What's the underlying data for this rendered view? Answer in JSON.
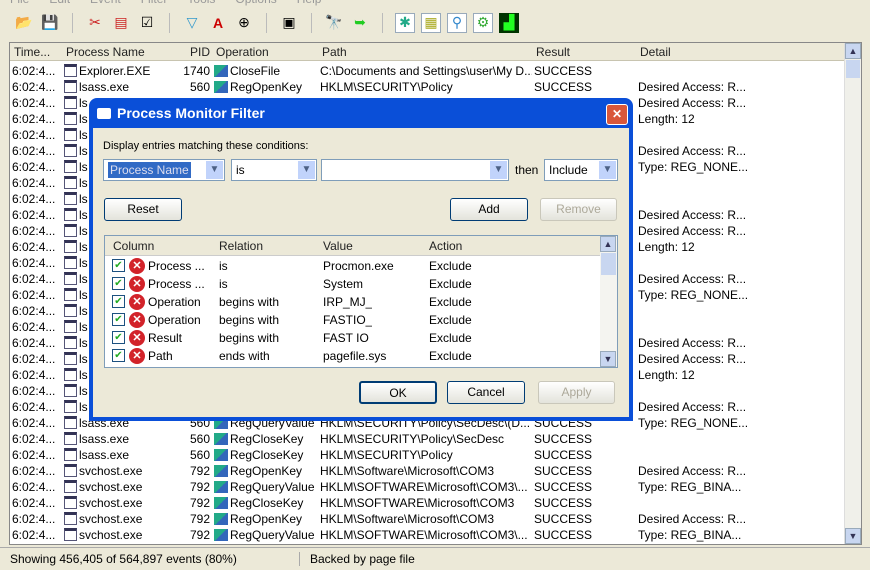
{
  "menu": [
    "File",
    "Edit",
    "Event",
    "Filter",
    "Tools",
    "Options",
    "Help"
  ],
  "columns": [
    "Time...",
    "Process Name",
    "PID",
    "Operation",
    "Path",
    "Result",
    "Detail"
  ],
  "rows": [
    {
      "time": "6:02:4...",
      "process": "Explorer.EXE",
      "pid": "1740",
      "op": "CloseFile",
      "path": "C:\\Documents and Settings\\user\\My D...",
      "result": "SUCCESS",
      "detail": ""
    },
    {
      "time": "6:02:4...",
      "process": "lsass.exe",
      "pid": "560",
      "op": "RegOpenKey",
      "path": "HKLM\\SECURITY\\Policy",
      "result": "SUCCESS",
      "detail": "Desired Access: R..."
    },
    {
      "time": "6:02:4...",
      "process": "ls",
      "pid": "",
      "op": "",
      "path": "",
      "result": "",
      "detail": "Desired Access: R..."
    },
    {
      "time": "6:02:4...",
      "process": "ls",
      "pid": "",
      "op": "",
      "path": "",
      "result": "",
      "detail": "Length: 12"
    },
    {
      "time": "6:02:4...",
      "process": "ls",
      "pid": "",
      "op": "",
      "path": "",
      "result": "",
      "detail": ""
    },
    {
      "time": "6:02:4...",
      "process": "ls",
      "pid": "",
      "op": "",
      "path": "",
      "result": "",
      "detail": "Desired Access: R..."
    },
    {
      "time": "6:02:4...",
      "process": "ls",
      "pid": "",
      "op": "",
      "path": "",
      "result": "",
      "detail": "Type: REG_NONE..."
    },
    {
      "time": "6:02:4...",
      "process": "ls",
      "pid": "",
      "op": "",
      "path": "",
      "result": "",
      "detail": ""
    },
    {
      "time": "6:02:4...",
      "process": "ls",
      "pid": "",
      "op": "",
      "path": "",
      "result": "",
      "detail": ""
    },
    {
      "time": "6:02:4...",
      "process": "ls",
      "pid": "",
      "op": "",
      "path": "",
      "result": "",
      "detail": "Desired Access: R..."
    },
    {
      "time": "6:02:4...",
      "process": "ls",
      "pid": "",
      "op": "",
      "path": "",
      "result": "",
      "detail": "Desired Access: R..."
    },
    {
      "time": "6:02:4...",
      "process": "ls",
      "pid": "",
      "op": "",
      "path": "",
      "result": "",
      "detail": "Length: 12"
    },
    {
      "time": "6:02:4...",
      "process": "ls",
      "pid": "",
      "op": "",
      "path": "",
      "result": "",
      "detail": ""
    },
    {
      "time": "6:02:4...",
      "process": "ls",
      "pid": "",
      "op": "",
      "path": "",
      "result": "",
      "detail": "Desired Access: R..."
    },
    {
      "time": "6:02:4...",
      "process": "ls",
      "pid": "",
      "op": "",
      "path": "",
      "result": "",
      "detail": "Type: REG_NONE..."
    },
    {
      "time": "6:02:4...",
      "process": "ls",
      "pid": "",
      "op": "",
      "path": "",
      "result": "",
      "detail": ""
    },
    {
      "time": "6:02:4...",
      "process": "ls",
      "pid": "",
      "op": "",
      "path": "",
      "result": "",
      "detail": ""
    },
    {
      "time": "6:02:4...",
      "process": "ls",
      "pid": "",
      "op": "",
      "path": "",
      "result": "",
      "detail": "Desired Access: R..."
    },
    {
      "time": "6:02:4...",
      "process": "ls",
      "pid": "",
      "op": "",
      "path": "",
      "result": "",
      "detail": "Desired Access: R..."
    },
    {
      "time": "6:02:4...",
      "process": "ls",
      "pid": "",
      "op": "",
      "path": "",
      "result": "",
      "detail": "Length: 12"
    },
    {
      "time": "6:02:4...",
      "process": "ls",
      "pid": "",
      "op": "",
      "path": "",
      "result": "",
      "detail": ""
    },
    {
      "time": "6:02:4...",
      "process": "ls",
      "pid": "",
      "op": "",
      "path": "",
      "result": "",
      "detail": "Desired Access: R..."
    },
    {
      "time": "6:02:4...",
      "process": "lsass.exe",
      "pid": "560",
      "op": "RegQueryValue",
      "path": "HKLM\\SECURITY\\Policy\\SecDesc\\(D...",
      "result": "SUCCESS",
      "detail": "Type: REG_NONE..."
    },
    {
      "time": "6:02:4...",
      "process": "lsass.exe",
      "pid": "560",
      "op": "RegCloseKey",
      "path": "HKLM\\SECURITY\\Policy\\SecDesc",
      "result": "SUCCESS",
      "detail": ""
    },
    {
      "time": "6:02:4...",
      "process": "lsass.exe",
      "pid": "560",
      "op": "RegCloseKey",
      "path": "HKLM\\SECURITY\\Policy",
      "result": "SUCCESS",
      "detail": ""
    },
    {
      "time": "6:02:4...",
      "process": "svchost.exe",
      "pid": "792",
      "op": "RegOpenKey",
      "path": "HKLM\\Software\\Microsoft\\COM3",
      "result": "SUCCESS",
      "detail": "Desired Access: R..."
    },
    {
      "time": "6:02:4...",
      "process": "svchost.exe",
      "pid": "792",
      "op": "RegQueryValue",
      "path": "HKLM\\SOFTWARE\\Microsoft\\COM3\\...",
      "result": "SUCCESS",
      "detail": "Type: REG_BINA..."
    },
    {
      "time": "6:02:4...",
      "process": "svchost.exe",
      "pid": "792",
      "op": "RegCloseKey",
      "path": "HKLM\\SOFTWARE\\Microsoft\\COM3",
      "result": "SUCCESS",
      "detail": ""
    },
    {
      "time": "6:02:4...",
      "process": "svchost.exe",
      "pid": "792",
      "op": "RegOpenKey",
      "path": "HKLM\\Software\\Microsoft\\COM3",
      "result": "SUCCESS",
      "detail": "Desired Access: R..."
    },
    {
      "time": "6:02:4...",
      "process": "svchost.exe",
      "pid": "792",
      "op": "RegQueryValue",
      "path": "HKLM\\SOFTWARE\\Microsoft\\COM3\\...",
      "result": "SUCCESS",
      "detail": "Type: REG_BINA..."
    }
  ],
  "status": {
    "events": "Showing 456,405 of 564,897 events (80%)",
    "backing": "Backed by page file"
  },
  "dialog": {
    "title": "Process Monitor Filter",
    "close": "✕",
    "prompt": "Display entries matching these conditions:",
    "column_select": "Process Name",
    "relation_select": "is",
    "value_select": "",
    "then_label": "then",
    "action_select": "Include",
    "reset": "Reset",
    "add": "Add",
    "remove": "Remove",
    "ok": "OK",
    "cancel": "Cancel",
    "apply": "Apply",
    "list_columns": [
      "Column",
      "Relation",
      "Value",
      "Action"
    ],
    "filters": [
      {
        "column": "Process ...",
        "relation": "is",
        "value": "Procmon.exe",
        "action": "Exclude"
      },
      {
        "column": "Process ...",
        "relation": "is",
        "value": "System",
        "action": "Exclude"
      },
      {
        "column": "Operation",
        "relation": "begins with",
        "value": "IRP_MJ_",
        "action": "Exclude"
      },
      {
        "column": "Operation",
        "relation": "begins with",
        "value": "FASTIO_",
        "action": "Exclude"
      },
      {
        "column": "Result",
        "relation": "begins with",
        "value": "FAST IO",
        "action": "Exclude"
      },
      {
        "column": "Path",
        "relation": "ends with",
        "value": "pagefile.sys",
        "action": "Exclude"
      }
    ]
  }
}
